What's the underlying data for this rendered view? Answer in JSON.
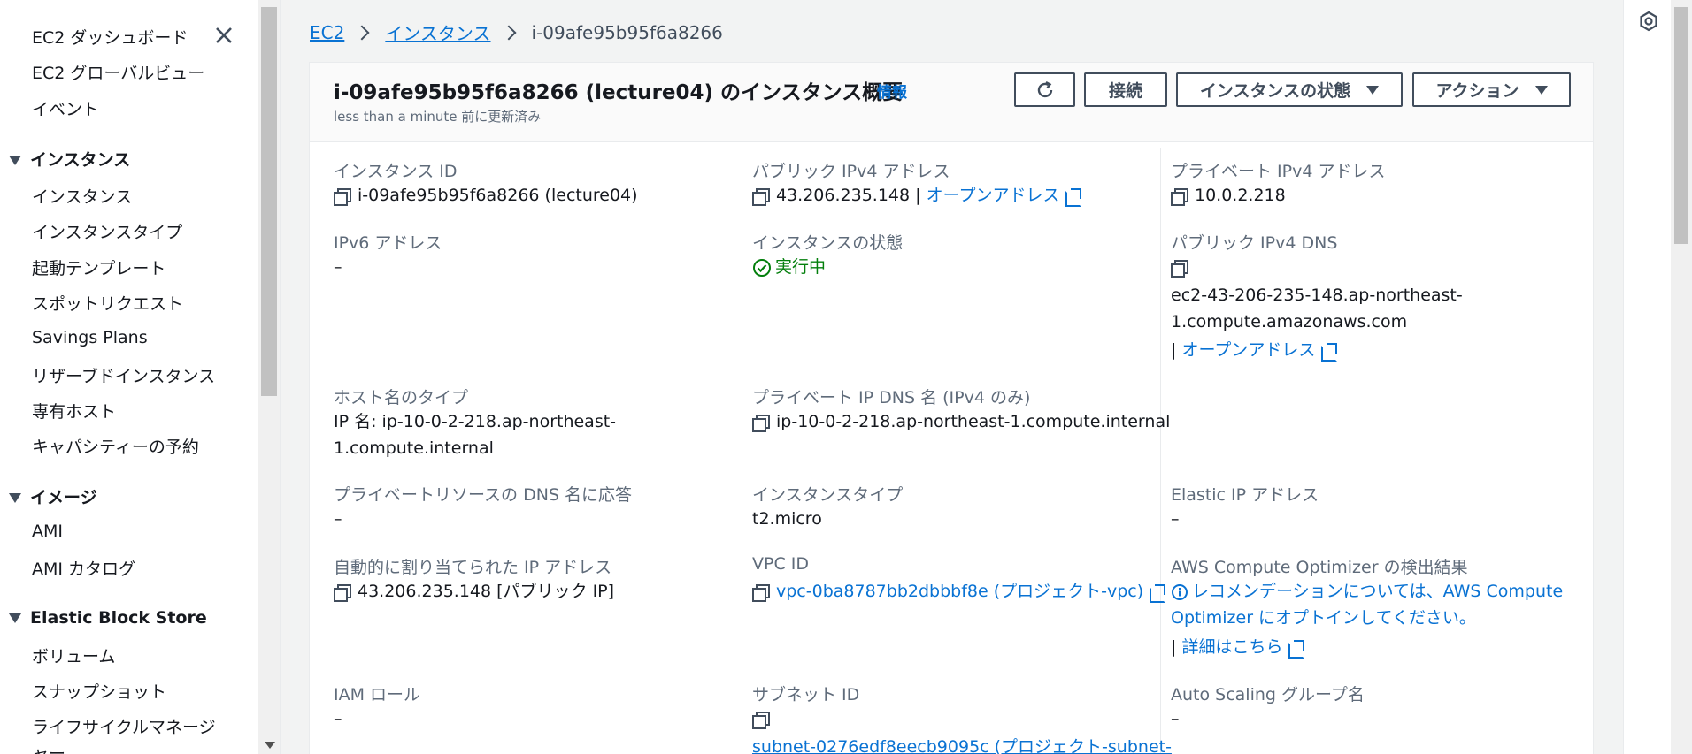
{
  "sidebar": {
    "items": [
      {
        "label": "EC2 ダッシュボード"
      },
      {
        "label": "EC2 グローバルビュー"
      },
      {
        "label": "イベント"
      }
    ],
    "sections": [
      {
        "title": "インスタンス",
        "items": [
          "インスタンス",
          "インスタンスタイプ",
          "起動テンプレート",
          "スポットリクエスト",
          "Savings Plans",
          "リザーブドインスタンス",
          "専有ホスト",
          "キャパシティーの予約"
        ]
      },
      {
        "title": "イメージ",
        "items": [
          "AMI",
          "AMI カタログ"
        ]
      },
      {
        "title": "Elastic Block Store",
        "items": [
          "ボリューム",
          "スナップショット",
          "ライフサイクルマネージャー"
        ]
      }
    ]
  },
  "breadcrumb": {
    "items": [
      "EC2",
      "インスタンス"
    ],
    "current": "i-09afe95b95f6a8266"
  },
  "panel": {
    "title": "i-09afe95b95f6a8266 (lecture04) のインスタンス概要",
    "info": "情報",
    "subtitle": "less than a minute 前に更新済み",
    "buttons": {
      "refresh": "",
      "connect": "接続",
      "state": "インスタンスの状態",
      "actions": "アクション"
    }
  },
  "details": {
    "instance_id": {
      "label": "インスタンス ID",
      "value": "i-09afe95b95f6a8266 (lecture04)"
    },
    "public_ipv4": {
      "label": "パブリック IPv4 アドレス",
      "value": "43.206.235.148",
      "link": "オープンアドレス"
    },
    "private_ipv4": {
      "label": "プライベート IPv4 アドレス",
      "value": "10.0.2.218"
    },
    "ipv6": {
      "label": "IPv6 アドレス",
      "value": "–"
    },
    "state": {
      "label": "インスタンスの状態",
      "value": "実行中"
    },
    "public_dns": {
      "label": "パブリック IPv4 DNS",
      "value_line1": "ec2-43-206-235-148.ap-northeast-",
      "value_line2": "1.compute.amazonaws.com",
      "link": "オープンアドレス"
    },
    "hostname_type": {
      "label": "ホスト名のタイプ",
      "value_line1": "IP 名: ip-10-0-2-218.ap-northeast-",
      "value_line2": "1.compute.internal"
    },
    "private_dns": {
      "label": "プライベート IP DNS 名 (IPv4 のみ)",
      "value": "ip-10-0-2-218.ap-northeast-1.compute.internal"
    },
    "private_resource_dns": {
      "label": "プライベートリソースの DNS 名に応答",
      "value": "–"
    },
    "instance_type": {
      "label": "インスタンスタイプ",
      "value": "t2.micro"
    },
    "elastic_ip": {
      "label": "Elastic IP アドレス",
      "value": "–"
    },
    "auto_ip": {
      "label": "自動的に割り当てられた IP アドレス",
      "value": "43.206.235.148 [パブリック IP]"
    },
    "vpc_id": {
      "label": "VPC ID",
      "value": "vpc-0ba8787bb2dbbbf8e (プロジェクト-vpc)"
    },
    "optimizer": {
      "label": "AWS Compute Optimizer の検出結果",
      "line1": "レコメンデーションについては、AWS Compute",
      "line2": "Optimizer にオプトインしてください。",
      "link": "詳細はこちら"
    },
    "iam_role": {
      "label": "IAM ロール",
      "value": "–"
    },
    "subnet_id": {
      "label": "サブネット ID",
      "value": "subnet-0276edf8eecb9095c (プロジェクト-subnet-"
    },
    "asg": {
      "label": "Auto Scaling グループ名",
      "value": "–"
    }
  },
  "colors": {
    "link": "#0972d3",
    "success": "#037f0c",
    "text": "#16191f",
    "label": "#5f6b7a"
  }
}
